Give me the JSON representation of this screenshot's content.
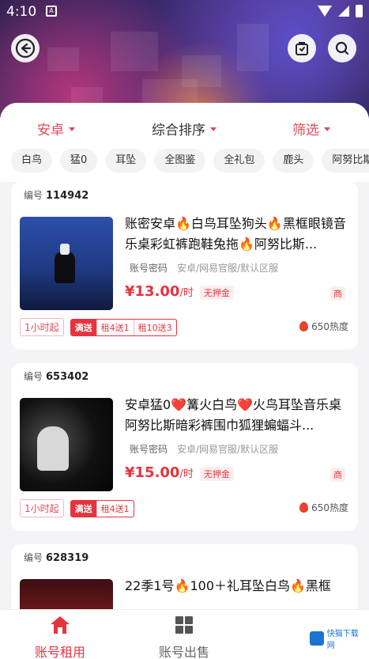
{
  "status_bar": {
    "time": "4:10",
    "app_badge": "A"
  },
  "filters": {
    "platform": "安卓",
    "sort": "综合排序",
    "filter": "筛选",
    "chips": [
      "白鸟",
      "猛0",
      "耳坠",
      "全图鉴",
      "全礼包",
      "鹿头",
      "阿努比斯"
    ]
  },
  "listings": [
    {
      "id_label": "编号",
      "id": "114942",
      "title": "账密安卓🔥白鸟耳坠狗头🔥黑框眼镜音乐桌彩虹裤跑鞋兔拖🔥阿努比斯...",
      "login_mode": "账号密码",
      "server": "安卓/网易官服/默认区服",
      "price": "¥13.00",
      "price_unit": "/时",
      "deposit": "无押金",
      "merchant": "商",
      "min_rent": "1小时起",
      "promo_label": "满送",
      "promos": [
        "租4送1",
        "租10送3"
      ],
      "heat": "650热度"
    },
    {
      "id_label": "编号",
      "id": "653402",
      "title": "安卓猛0❤️篝火白鸟❤️火鸟耳坠音乐桌阿努比斯暗彩裤围巾狐狸蝙蝠斗...",
      "login_mode": "账号密码",
      "server": "安卓/网易官服/默认区服",
      "price": "¥15.00",
      "price_unit": "/时",
      "deposit": "无押金",
      "merchant": "商",
      "min_rent": "1小时起",
      "promo_label": "满送",
      "promos": [
        "租4送1"
      ],
      "heat": "650热度"
    },
    {
      "id_label": "编号",
      "id": "628319",
      "title": "22季1号🔥100＋礼耳坠白鸟🔥黑框"
    }
  ],
  "bottom_nav": {
    "rent_label": "账号租用",
    "sell_label": "账号出售"
  },
  "watermark": {
    "text": "快猫下载网"
  },
  "colors": {
    "accent": "#e6343f",
    "accent_light": "#e04a5b"
  }
}
